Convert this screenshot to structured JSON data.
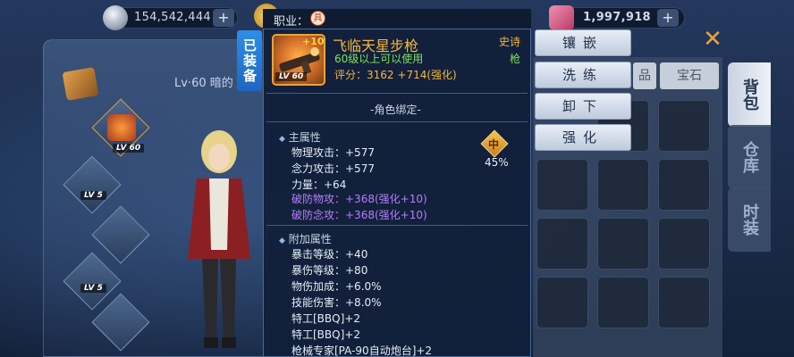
{
  "currency": {
    "silver": "154,542,444",
    "gems": "1,997,918"
  },
  "tooltip": {
    "job_label": "职业：",
    "job_icon_glyph": "具",
    "equipped_label": "已装备",
    "item_name": "飞临天星步枪",
    "item_plus": "+10",
    "item_level_badge": "LV 60",
    "rarity": "史诗",
    "requirement": "60级以上可以使用",
    "weapon_type": "枪",
    "score_label": "评分：",
    "score_base": "3162",
    "score_bonus": "+714(强化)",
    "bind_text": "-角色绑定-",
    "main_attr_title": "主属性",
    "main_attrs": [
      "物理攻击：+577",
      "念力攻击：+577",
      "力量：+64"
    ],
    "main_attrs_enhanced": [
      "破防物攻：+368(强化+10)",
      "破防念攻：+368(强化+10)"
    ],
    "tier_glyph": "中",
    "tier_percent": "45%",
    "extra_attr_title": "附加属性",
    "extra_attrs": [
      "暴击等级：+40",
      "暴伤等级：+80",
      "物伤加成：+6.0%",
      "技能伤害：+8.0%",
      "特工[BBQ]+2",
      "特工[BBQ]+2",
      "枪械专家[PA-90自动炮台]+2"
    ]
  },
  "actions": [
    "镶嵌",
    "洗练",
    "卸下",
    "强化"
  ],
  "left_panel": {
    "level_text": "Lv·60 暗的",
    "slot_levels": [
      "LV 60",
      "LV 5",
      "LV 5"
    ]
  },
  "right_panel": {
    "filter_tabs": [
      "品",
      "宝石"
    ],
    "side_tabs": [
      "背包",
      "仓库",
      "时装"
    ]
  },
  "colors": {
    "accent_gold": "#f6b73c",
    "attr_green": "#7be35a",
    "enhance_purple": "#b77cff",
    "equipped_blue": "#2a86e0"
  }
}
